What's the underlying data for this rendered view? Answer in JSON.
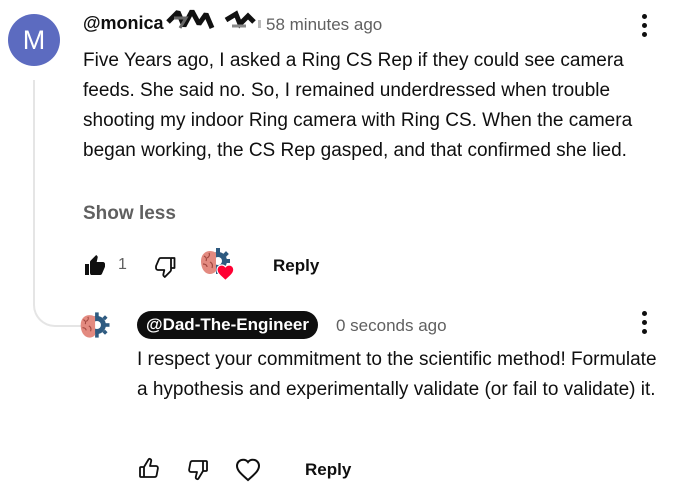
{
  "comment": {
    "avatar_letter": "M",
    "author": "@monica",
    "timestamp": "58 minutes ago",
    "text": "Five Years ago, I asked a Ring CS Rep if they could see camera feeds. She said no. So, I remained underdressed when trouble shooting my indoor Ring camera with Ring CS. When the camera began working, the CS Rep gasped, and that confirmed she lied.",
    "show_less_label": "Show less",
    "like_count": "1",
    "reply_label": "Reply"
  },
  "reply": {
    "author": "@Dad-The-Engineer",
    "timestamp": "0 seconds ago",
    "text": "I respect your commitment to the scientific method! Formulate a hypothesis and experimentally validate (or fail to validate) it.",
    "reply_label": "Reply"
  },
  "icons": {
    "like": "thumbs-up-icon",
    "dislike": "thumbs-down-icon",
    "heart": "heart-icon",
    "more": "more-vertical-icon",
    "creator_avatar": "brain-gear-avatar"
  },
  "colors": {
    "avatar_bg": "#5c6bc0",
    "creator_heart": "#ff0033",
    "handle_chip_bg": "#0f0f0f",
    "secondary_text": "#606060"
  }
}
